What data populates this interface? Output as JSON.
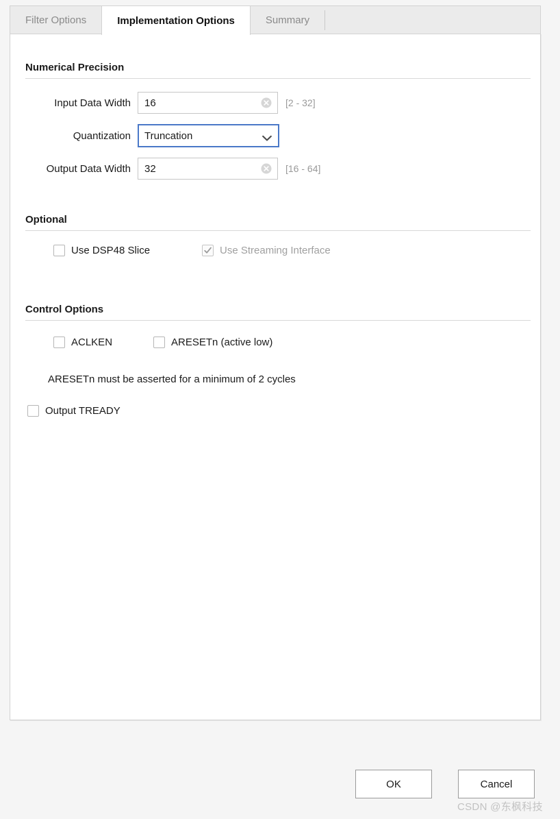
{
  "tabs": [
    {
      "label": "Filter Options",
      "active": false
    },
    {
      "label": "Implementation Options",
      "active": true
    },
    {
      "label": "Summary",
      "active": false
    }
  ],
  "sections": {
    "numerical": {
      "title": "Numerical Precision",
      "fields": {
        "input_data_width": {
          "label": "Input Data Width",
          "value": "16",
          "range": "[2 - 32]"
        },
        "quantization": {
          "label": "Quantization",
          "value": "Truncation"
        },
        "output_data_width": {
          "label": "Output Data Width",
          "value": "32",
          "range": "[16 - 64]"
        }
      }
    },
    "optional": {
      "title": "Optional",
      "checkboxes": [
        {
          "label": "Use DSP48 Slice",
          "checked": false,
          "disabled": false
        },
        {
          "label": "Use Streaming Interface",
          "checked": true,
          "disabled": true
        }
      ]
    },
    "control": {
      "title": "Control Options",
      "checkboxes": [
        {
          "label": "ACLKEN",
          "checked": false,
          "disabled": false
        },
        {
          "label": "ARESETn (active low)",
          "checked": false,
          "disabled": false
        },
        {
          "label": "Output TREADY",
          "checked": false,
          "disabled": false
        }
      ],
      "note": "ARESETn must be asserted for a minimum of 2 cycles"
    }
  },
  "footer": {
    "ok_label": "OK",
    "cancel_label": "Cancel"
  },
  "watermark": "CSDN @东枫科技",
  "colors": {
    "focus_border": "#4a78c8",
    "panel_bg": "#ffffff",
    "page_bg": "#f5f5f5",
    "tab_inactive_bg": "#ebebeb",
    "muted_text": "#9a9a9a"
  }
}
